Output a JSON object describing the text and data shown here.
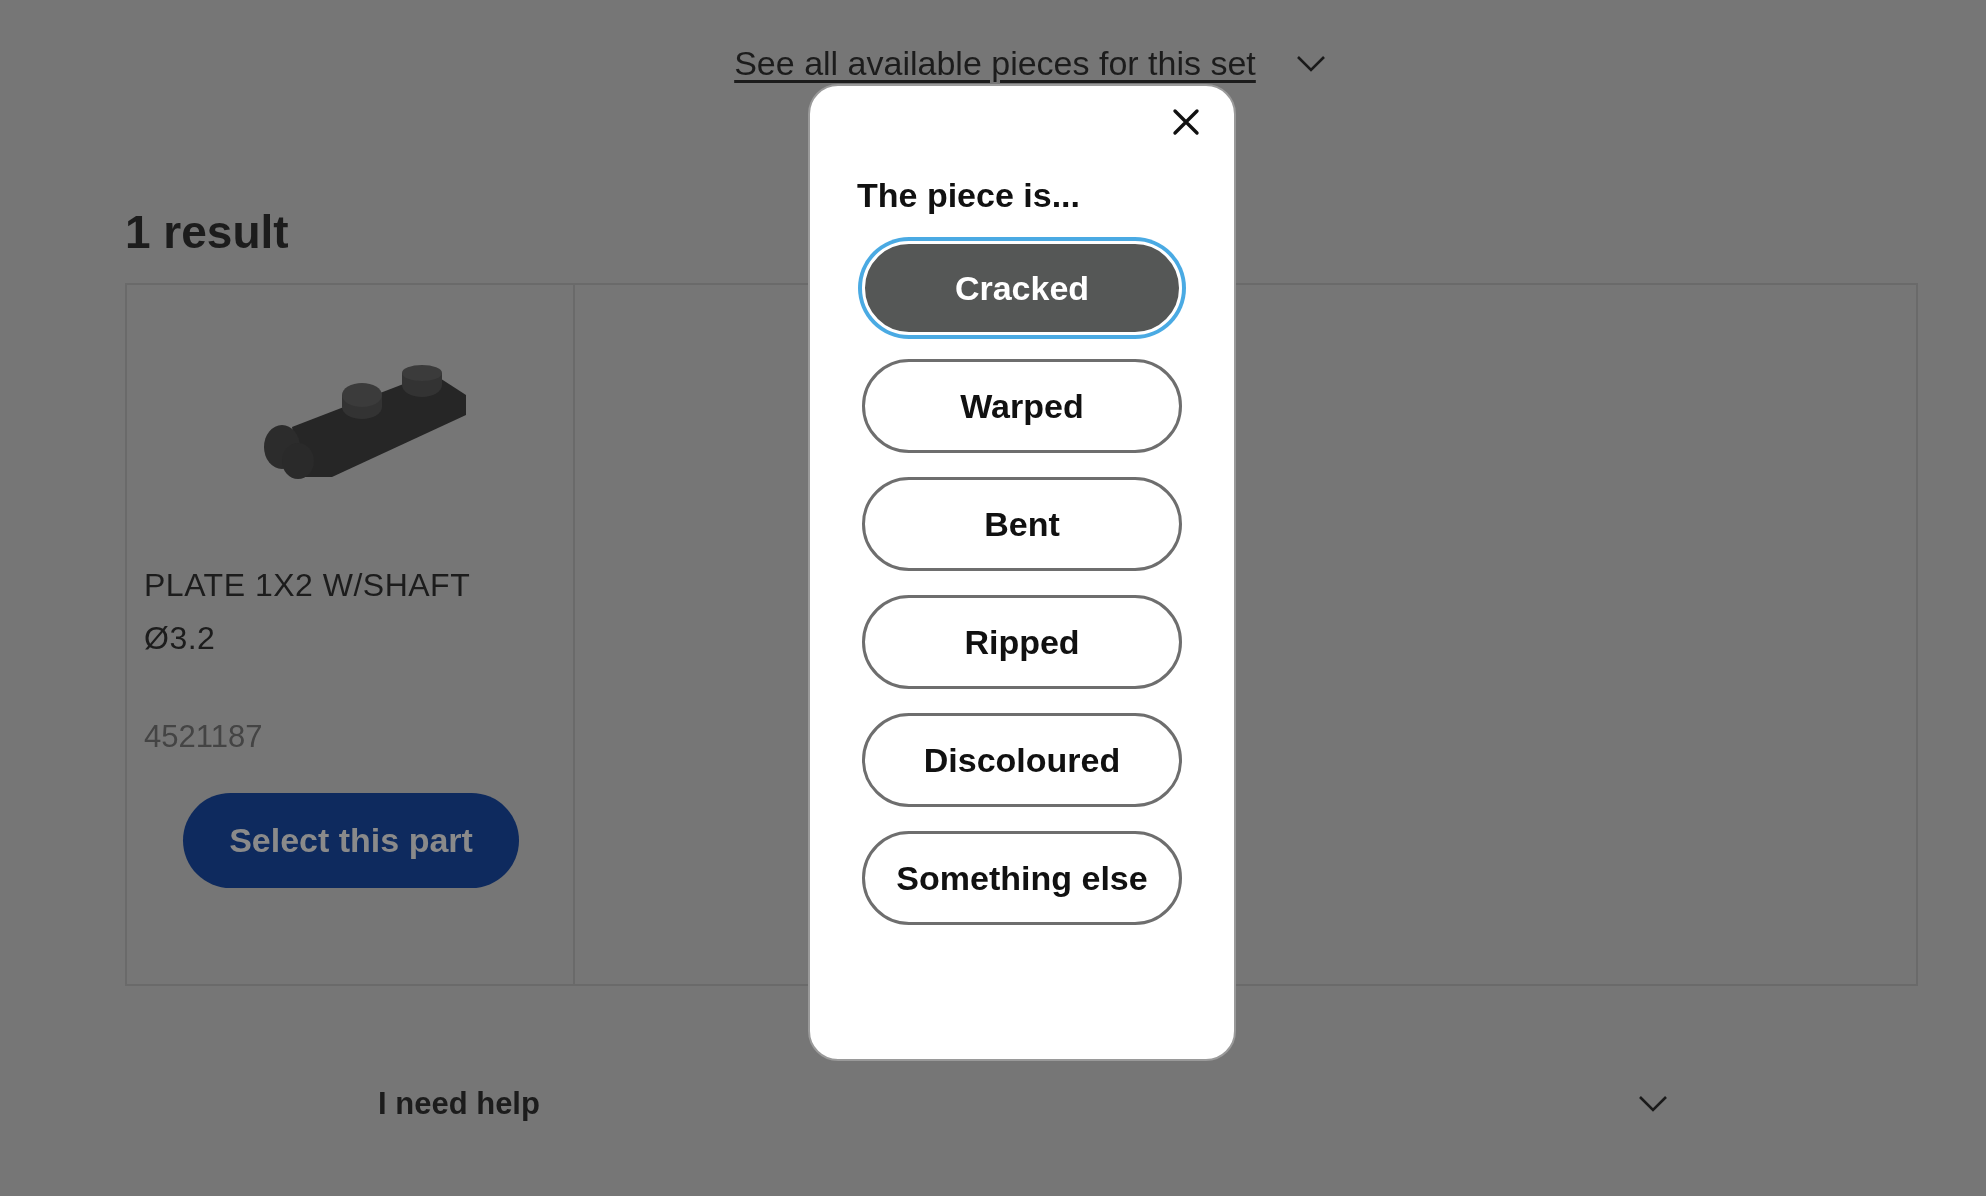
{
  "page": {
    "pieces_link": "See all available pieces for this set",
    "result_count": "1 result",
    "results": [
      {
        "name": "PLATE 1X2 W/SHAFT Ø3.2",
        "part_number": "4521187",
        "button": "Select this part"
      }
    ],
    "help": "I need help"
  },
  "dialog": {
    "heading": "The piece is...",
    "options": [
      {
        "label": "Cracked",
        "selected": true
      },
      {
        "label": "Warped",
        "selected": false
      },
      {
        "label": "Bent",
        "selected": false
      },
      {
        "label": "Ripped",
        "selected": false
      },
      {
        "label": "Discoloured",
        "selected": false
      },
      {
        "label": "Something else",
        "selected": false
      }
    ]
  }
}
